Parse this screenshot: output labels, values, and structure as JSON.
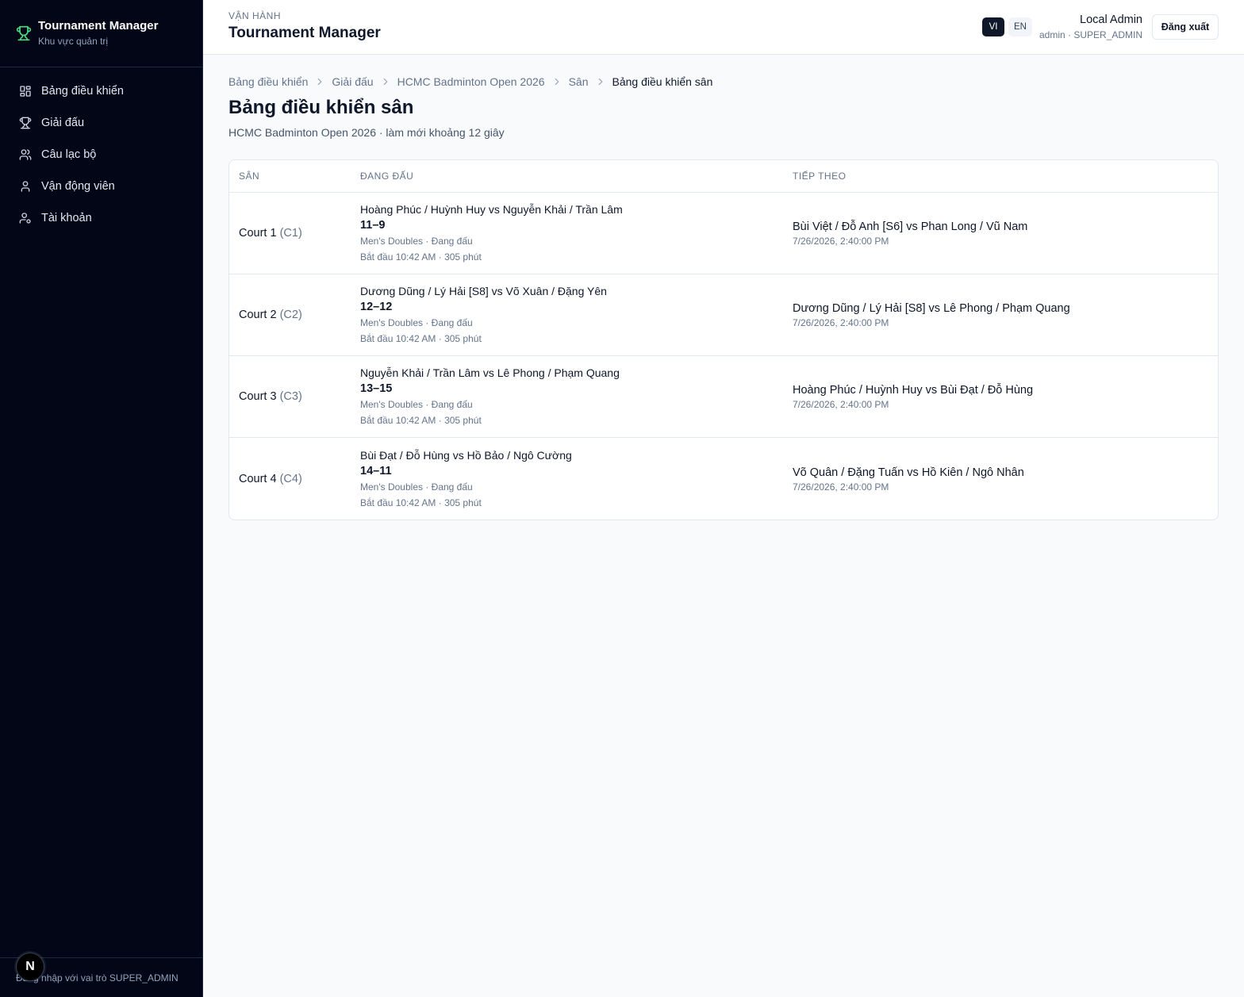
{
  "sidebar": {
    "brand_title": "Tournament Manager",
    "brand_subtitle": "Khu vực quản trị",
    "items": [
      {
        "label": "Bảng điều khiển",
        "icon": "dashboard-icon"
      },
      {
        "label": "Giải đấu",
        "icon": "trophy-icon"
      },
      {
        "label": "Câu lạc bộ",
        "icon": "users-icon"
      },
      {
        "label": "Vận động viên",
        "icon": "user-icon"
      },
      {
        "label": "Tài khoản",
        "icon": "user-cog-icon"
      }
    ],
    "footer_text": "Đăng nhập với vai trò SUPER_ADMIN",
    "badge_letter": "N"
  },
  "header": {
    "kicker": "VẬN HÀNH",
    "title": "Tournament Manager",
    "lang_vi": "VI",
    "lang_en": "EN",
    "user_name": "Local Admin",
    "user_role": "admin · SUPER_ADMIN",
    "logout_label": "Đăng xuất"
  },
  "breadcrumb": [
    "Bảng điều khiển",
    "Giải đấu",
    "HCMC Badminton Open 2026",
    "Sân",
    "Bảng điều khiển sân"
  ],
  "page": {
    "title": "Bảng điều khiển sân",
    "subtitle": "HCMC Badminton Open 2026 · làm mới khoảng 12 giây"
  },
  "table": {
    "headers": [
      "SÂN",
      "ĐANG ĐẤU",
      "TIẾP THEO"
    ],
    "rows": [
      {
        "court": "Court 1",
        "code": "(C1)",
        "match": "Hoàng Phúc / Huỳnh Huy vs Nguyễn Khải / Trần Lâm",
        "score": "11–9",
        "event": "Men's Doubles · Đang đấu",
        "start": "Bắt đầu 10:42 AM · 305 phút",
        "next": "Bùi Việt / Đỗ Anh [S6] vs Phan Long / Vũ Nam",
        "next_time": "7/26/2026, 2:40:00 PM"
      },
      {
        "court": "Court 2",
        "code": "(C2)",
        "match": "Dương Dũng / Lý Hải [S8] vs Võ Xuân / Đặng Yên",
        "score": "12–12",
        "event": "Men's Doubles · Đang đấu",
        "start": "Bắt đầu 10:42 AM · 305 phút",
        "next": "Dương Dũng / Lý Hải [S8] vs Lê Phong / Phạm Quang",
        "next_time": "7/26/2026, 2:40:00 PM"
      },
      {
        "court": "Court 3",
        "code": "(C3)",
        "match": "Nguyễn Khải / Trần Lâm vs Lê Phong / Phạm Quang",
        "score": "13–15",
        "event": "Men's Doubles · Đang đấu",
        "start": "Bắt đầu 10:42 AM · 305 phút",
        "next": "Hoàng Phúc / Huỳnh Huy vs Bùi Đạt / Đỗ Hùng",
        "next_time": "7/26/2026, 2:40:00 PM"
      },
      {
        "court": "Court 4",
        "code": "(C4)",
        "match": "Bùi Đạt / Đỗ Hùng vs Hồ Bảo / Ngô Cường",
        "score": "14–11",
        "event": "Men's Doubles · Đang đấu",
        "start": "Bắt đầu 10:42 AM · 305 phút",
        "next": "Võ Quân / Đặng Tuấn vs Hồ Kiên / Ngô Nhân",
        "next_time": "7/26/2026, 2:40:00 PM"
      }
    ]
  }
}
